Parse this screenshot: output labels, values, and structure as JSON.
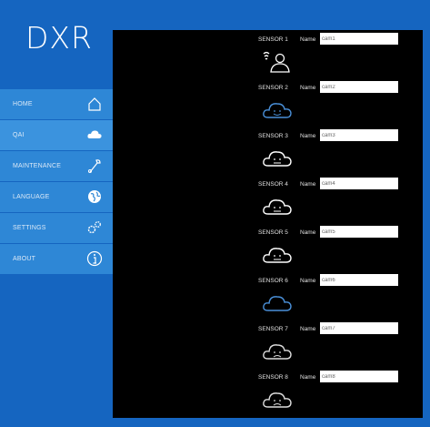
{
  "app": {
    "logo": "DXR"
  },
  "nav": [
    {
      "label": "HOME",
      "icon": "home-icon"
    },
    {
      "label": "QAI",
      "icon": "cloud-icon"
    },
    {
      "label": "MAINTENANCE",
      "icon": "wrench-icon"
    },
    {
      "label": "LANGUAGE",
      "icon": "globe-icon"
    },
    {
      "label": "SETTINGS",
      "icon": "gears-icon"
    },
    {
      "label": "ABOUT",
      "icon": "info-icon"
    }
  ],
  "sensors": [
    {
      "title": "SENSOR 1",
      "name_label": "Name",
      "name_value": "cam1",
      "icon": "person-signal-icon",
      "status_color": "#ffffff"
    },
    {
      "title": "SENSOR 2",
      "name_label": "Name",
      "name_value": "cam2",
      "icon": "happy-cloud-icon",
      "status_color": "#4a90d9"
    },
    {
      "title": "SENSOR 3",
      "name_label": "Name",
      "name_value": "cam3",
      "icon": "neutral-cloud-icon",
      "status_color": "#ffffff"
    },
    {
      "title": "SENSOR 4",
      "name_label": "Name",
      "name_value": "cam4",
      "icon": "neutral-cloud-icon",
      "status_color": "#ffffff"
    },
    {
      "title": "SENSOR 5",
      "name_label": "Name",
      "name_value": "cam5",
      "icon": "neutral-cloud-icon",
      "status_color": "#ffffff"
    },
    {
      "title": "SENSOR 6",
      "name_label": "Name",
      "name_value": "cam6",
      "icon": "happy-cloud-icon",
      "status_color": "#4a90d9"
    },
    {
      "title": "SENSOR 7",
      "name_label": "Name",
      "name_value": "cam7",
      "icon": "sad-cloud-icon",
      "status_color": "#dddddd"
    },
    {
      "title": "SENSOR 8",
      "name_label": "Name",
      "name_value": "cam8",
      "icon": "sad-cloud-icon",
      "status_color": "#dddddd"
    }
  ]
}
